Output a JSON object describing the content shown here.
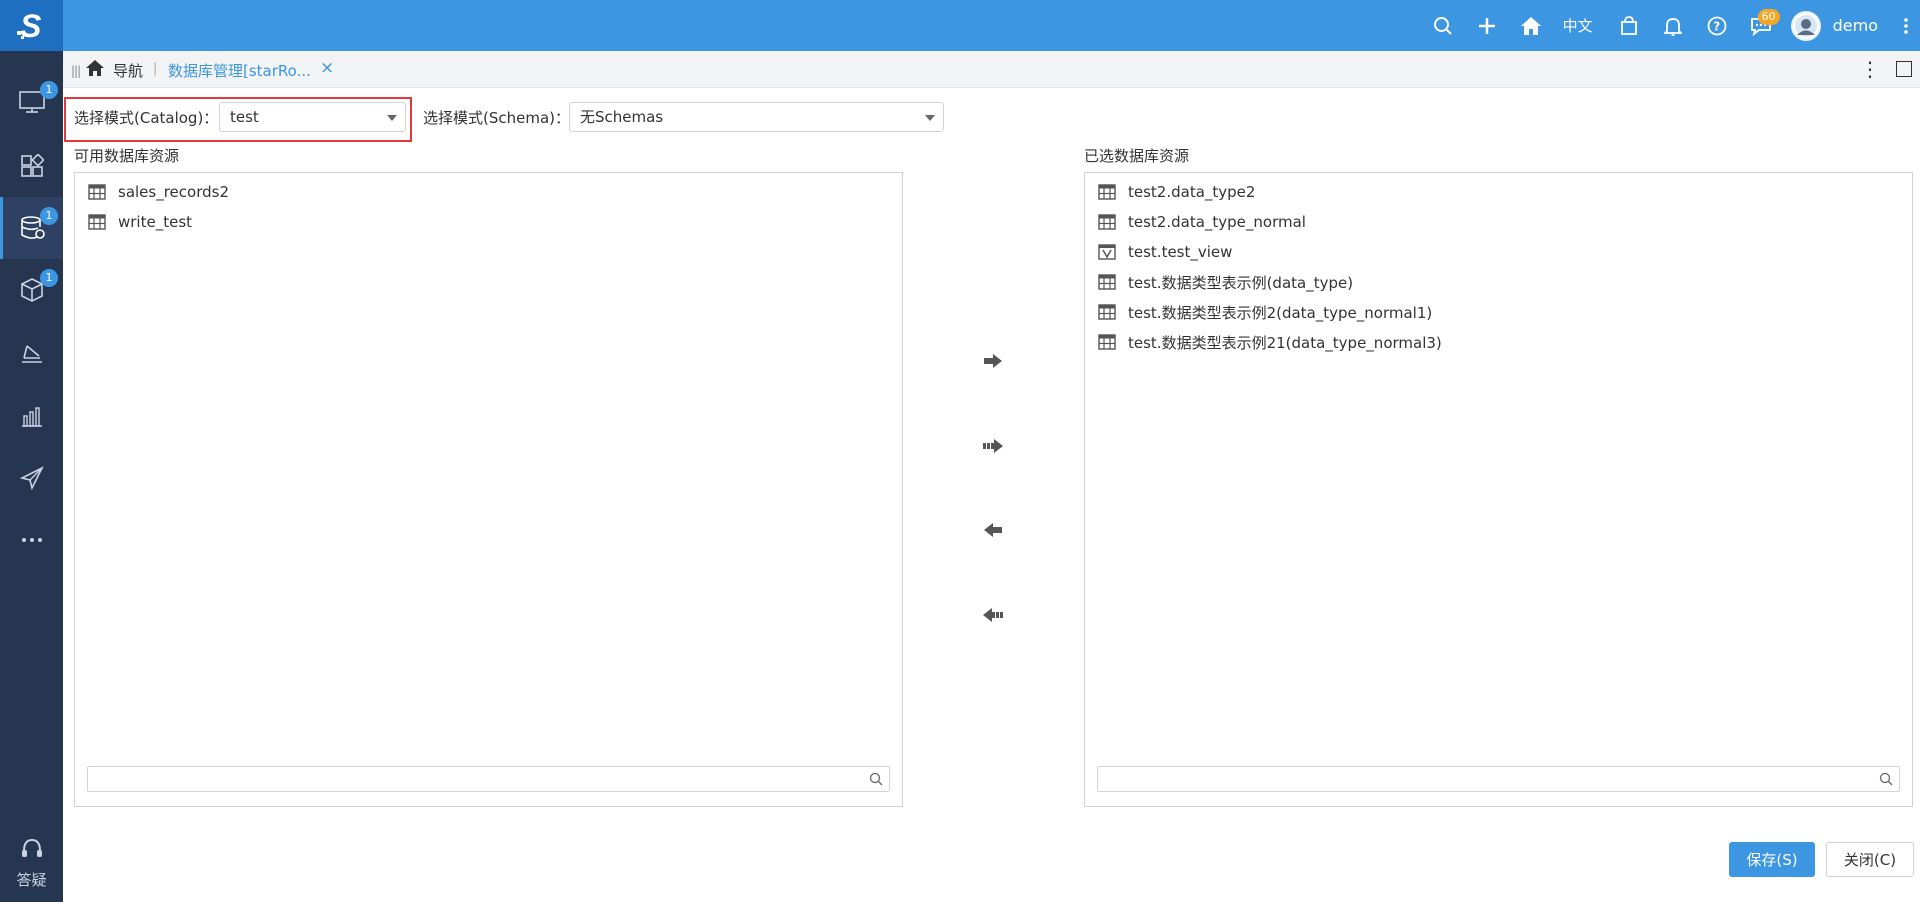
{
  "topbar": {
    "language": "中文",
    "message_badge": "60",
    "user_name": "demo"
  },
  "sidebar": {
    "badges": [
      "1",
      "1",
      "1"
    ],
    "help_label": "答疑"
  },
  "tabs": {
    "nav_label": "导航",
    "active_tab": "数据库管理[starRo..."
  },
  "selectors": {
    "catalog_label": "选择模式(Catalog)：",
    "catalog_value": "test",
    "schema_label": "选择模式(Schema)：",
    "schema_value": "无Schemas"
  },
  "available": {
    "title": "可用数据库资源",
    "items": [
      {
        "label": "sales_records2",
        "icon": "table-icon"
      },
      {
        "label": "write_test",
        "icon": "table-icon"
      }
    ]
  },
  "selected": {
    "title": "已选数据库资源",
    "items": [
      {
        "label": "test2.data_type2",
        "icon": "table-icon"
      },
      {
        "label": "test2.data_type_normal",
        "icon": "table-icon"
      },
      {
        "label": "test.test_view",
        "icon": "view-icon"
      },
      {
        "label": "test.数据类型表示例(data_type)",
        "icon": "table-icon"
      },
      {
        "label": "test.数据类型表示例2(data_type_normal1)",
        "icon": "table-icon"
      },
      {
        "label": "test.数据类型表示例21(data_type_normal3)",
        "icon": "table-icon"
      }
    ]
  },
  "footer": {
    "save_label": "保存(S)",
    "close_label": "关闭(C)"
  }
}
